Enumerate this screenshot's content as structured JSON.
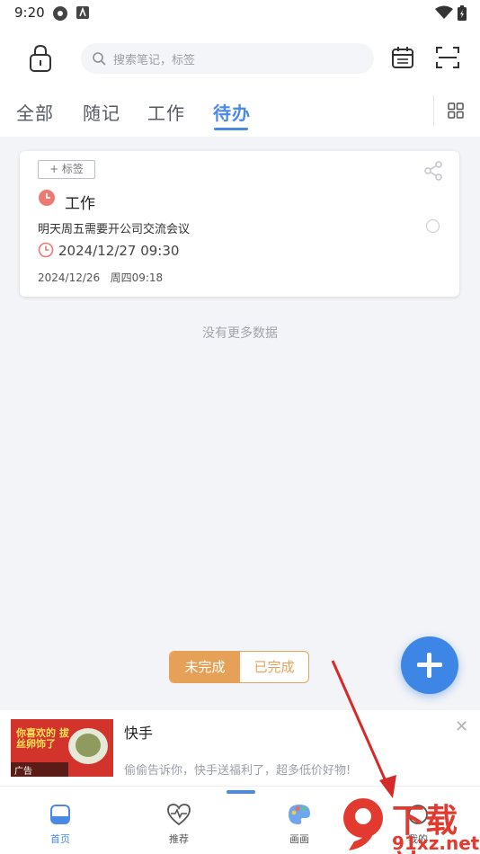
{
  "status_bar": {
    "time": "9:20"
  },
  "search": {
    "placeholder": "搜索笔记，标签"
  },
  "tabs": [
    {
      "label": "全部"
    },
    {
      "label": "随记"
    },
    {
      "label": "工作"
    },
    {
      "label": "待办"
    }
  ],
  "card": {
    "tag_button": "+ 标签",
    "title": "工作",
    "description": "明天周五需要开公司交流会议",
    "due": "2024/12/27 09:30",
    "created": "2024/12/26   周四09:18"
  },
  "empty_text": "没有更多数据",
  "segment": {
    "left": "未完成",
    "right": "已完成"
  },
  "ad": {
    "title": "快手",
    "description": "偷偷告诉你，快手送福利了，超多低价好物!",
    "image_text": "你喜欢的 拔丝卵饰了",
    "image_label": "广告"
  },
  "nav": [
    {
      "label": "首页"
    },
    {
      "label": "推荐"
    },
    {
      "label": "画画"
    },
    {
      "label": "我的"
    }
  ],
  "watermark": {
    "text": "下载站",
    "url": "91xz.net",
    "digits": "9"
  },
  "colors": {
    "accent": "#4a8ae6",
    "orange": "#e6a159",
    "fab": "#3d86e6"
  }
}
